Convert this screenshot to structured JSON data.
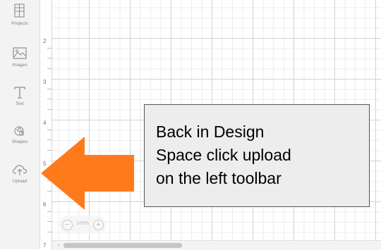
{
  "sidebar": {
    "items": [
      {
        "label": "Projects",
        "icon": "projects-icon"
      },
      {
        "label": "Images",
        "icon": "image-icon"
      },
      {
        "label": "Text",
        "icon": "text-icon"
      },
      {
        "label": "Shapes",
        "icon": "shapes-icon"
      },
      {
        "label": "Upload",
        "icon": "upload-icon"
      }
    ]
  },
  "ruler": {
    "numbers": [
      "2",
      "3",
      "4",
      "5",
      "6",
      "7"
    ]
  },
  "zoom": {
    "minus": "−",
    "value": "100%",
    "plus": "+"
  },
  "scrollbar": {
    "left_arrow": "‹"
  },
  "callout": {
    "lines": [
      "Back in Design",
      "Space click upload",
      "on the left toolbar"
    ]
  },
  "colors": {
    "arrow": "#ff7a1a",
    "sidebar_bg": "#f3f3f4",
    "callout_bg": "#ededed"
  }
}
